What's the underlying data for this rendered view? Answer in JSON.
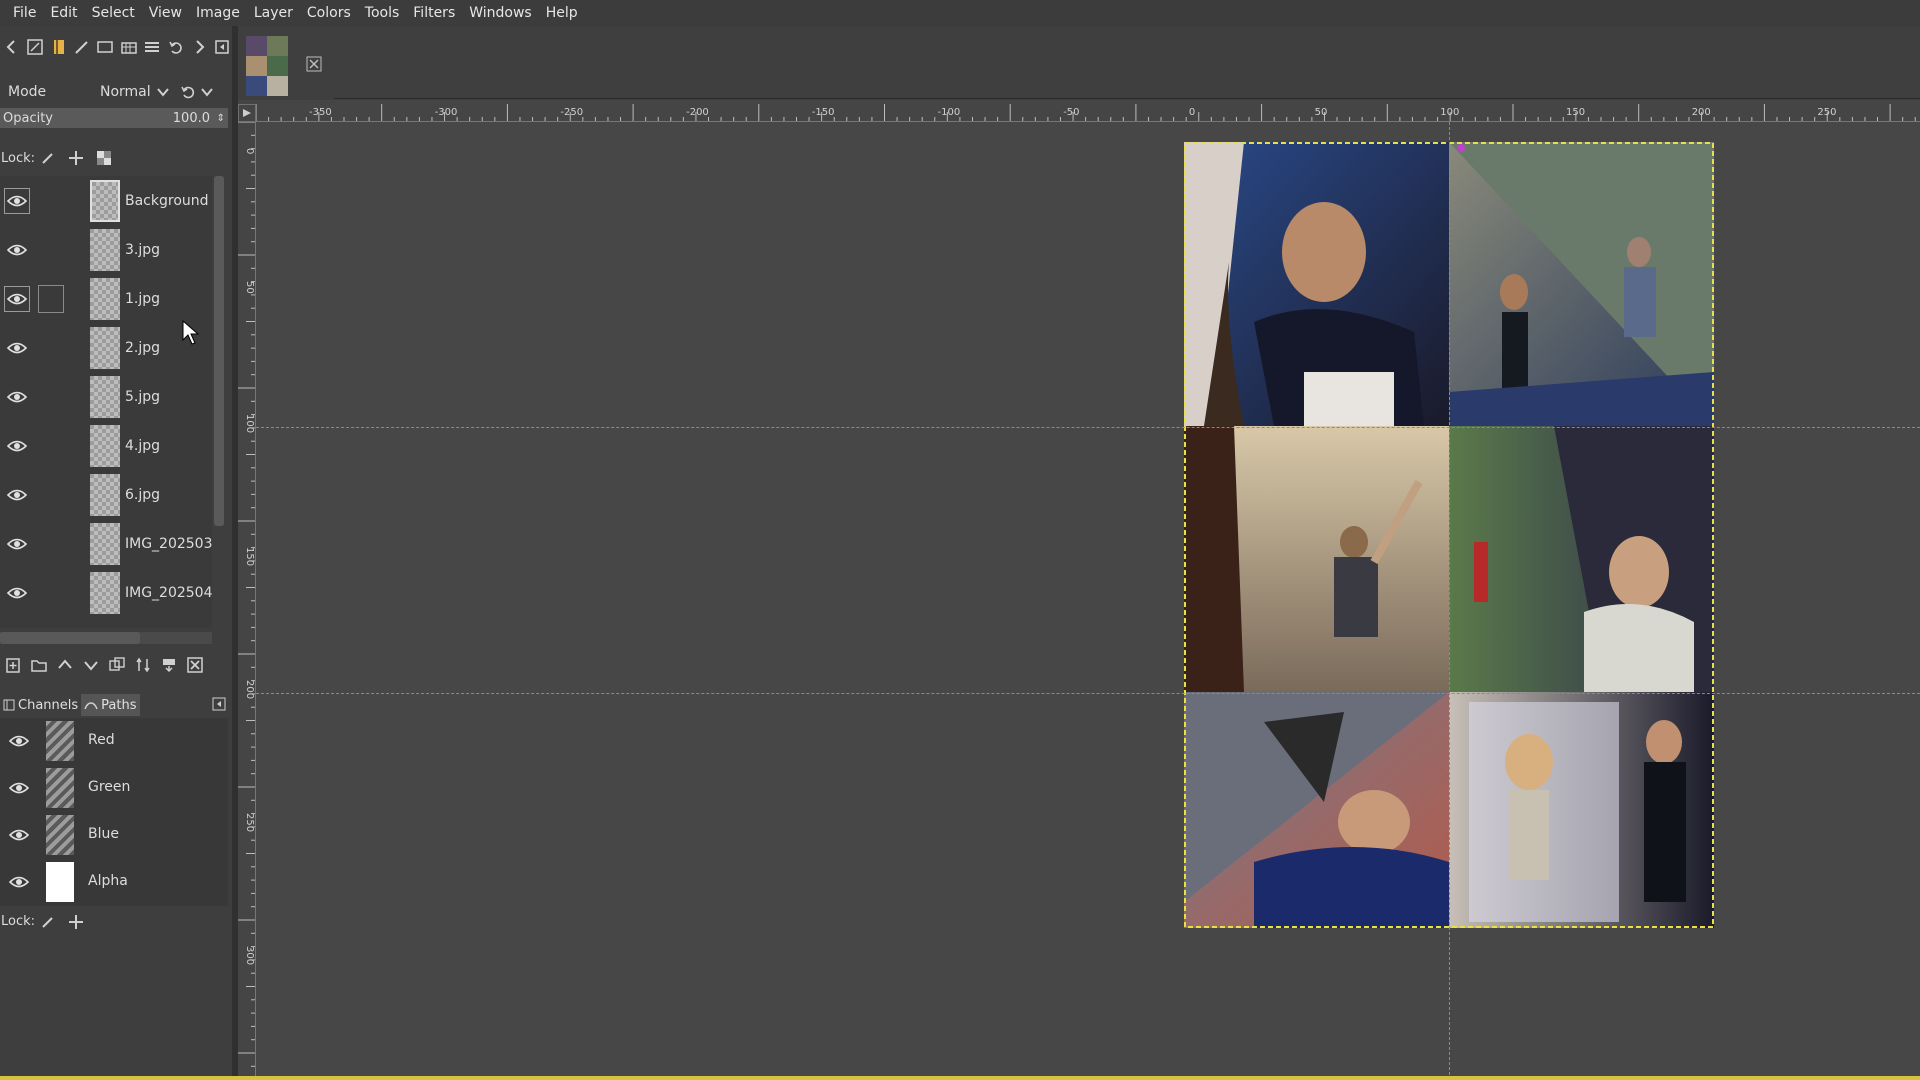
{
  "menubar": {
    "items": [
      "File",
      "Edit",
      "Select",
      "View",
      "Image",
      "Layer",
      "Colors",
      "Tools",
      "Filters",
      "Windows",
      "Help"
    ]
  },
  "tool_options": {
    "mode_label": "Mode",
    "mode_value": "Normal",
    "opacity_label": "Opacity",
    "opacity_value": "100.0",
    "lock_label": "Lock:"
  },
  "layers": [
    {
      "name": "Background",
      "visible": true
    },
    {
      "name": "3.jpg",
      "visible": true
    },
    {
      "name": "1.jpg",
      "visible": true
    },
    {
      "name": "2.jpg",
      "visible": true
    },
    {
      "name": "5.jpg",
      "visible": true
    },
    {
      "name": "4.jpg",
      "visible": true
    },
    {
      "name": "6.jpg",
      "visible": true
    },
    {
      "name": "IMG_202503",
      "visible": true
    },
    {
      "name": "IMG_202504",
      "visible": true
    }
  ],
  "dock_tabs": {
    "channels": "Channels",
    "paths": "Paths"
  },
  "channels": [
    {
      "name": "Red"
    },
    {
      "name": "Green"
    },
    {
      "name": "Blue"
    },
    {
      "name": "Alpha"
    }
  ],
  "channels_lock_label": "Lock:",
  "rulers": {
    "horizontal_labels": [
      "-350",
      "-300",
      "-250",
      "-200",
      "-150",
      "-100",
      "-50",
      "0",
      "50",
      "100",
      "150",
      "200",
      "250"
    ],
    "vertical_labels": [
      "0",
      "50",
      "100",
      "150",
      "200",
      "250",
      "300"
    ]
  },
  "colors": {
    "guide": "#36a8c8",
    "selection_border": "#e8e04a",
    "panel_bg": "#3e3e3e"
  }
}
